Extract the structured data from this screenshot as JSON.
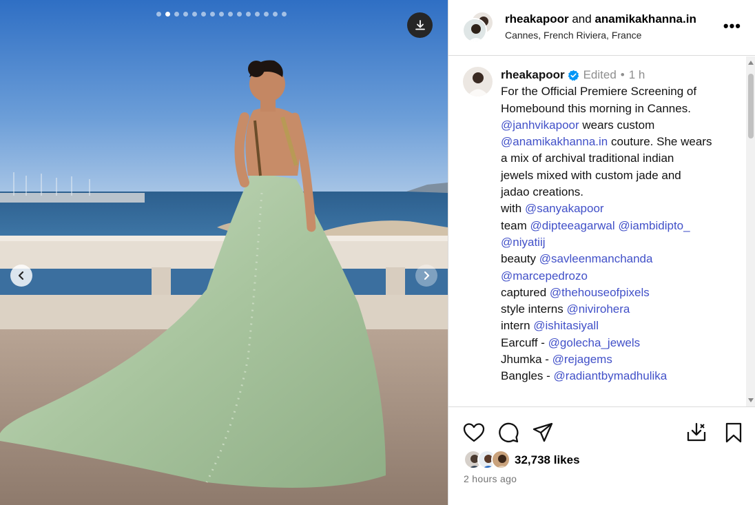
{
  "carousel": {
    "dot_count": 15,
    "active_index": 1
  },
  "header": {
    "user1": "rheakapoor",
    "joiner": "and",
    "user2": "anamikakhanna.in",
    "location": "Cannes, French Riviera, France",
    "more_label": "•••"
  },
  "caption": {
    "username": "rheakapoor",
    "edited": "Edited",
    "separator": "•",
    "time": "1 h",
    "lines": [
      [
        {
          "t": "For the Official Premiere Screening of"
        }
      ],
      [
        {
          "t": "Homebound this morning in Cannes."
        }
      ],
      [
        {
          "t": "@janhvikapoor",
          "m": true
        },
        {
          "t": " wears custom"
        }
      ],
      [
        {
          "t": "@anamikakhanna.in",
          "m": true
        },
        {
          "t": " couture. She wears"
        }
      ],
      [
        {
          "t": "a mix of archival traditional indian"
        }
      ],
      [
        {
          "t": "jewels mixed with custom jade and"
        }
      ],
      [
        {
          "t": "jadao creations."
        }
      ],
      [
        {
          "t": " "
        }
      ],
      [
        {
          "t": "with "
        },
        {
          "t": "@sanyakapoor",
          "m": true
        }
      ],
      [
        {
          "t": "team "
        },
        {
          "t": "@dipteeagarwal",
          "m": true
        },
        {
          "t": " "
        },
        {
          "t": "@iambidipto_",
          "m": true
        }
      ],
      [
        {
          "t": "@niyatiij",
          "m": true
        }
      ],
      [
        {
          "t": "beauty "
        },
        {
          "t": "@savleenmanchanda",
          "m": true
        }
      ],
      [
        {
          "t": "@marcepedrozo",
          "m": true
        }
      ],
      [
        {
          "t": "captured "
        },
        {
          "t": "@thehouseofpixels",
          "m": true
        }
      ],
      [
        {
          "t": "style interns "
        },
        {
          "t": "@nivirohera",
          "m": true
        }
      ],
      [
        {
          "t": "intern "
        },
        {
          "t": "@ishitasiyall",
          "m": true
        }
      ],
      [
        {
          "t": "Earcuff - "
        },
        {
          "t": "@golecha_jewels",
          "m": true
        }
      ],
      [
        {
          "t": "Jhumka - "
        },
        {
          "t": "@rejagems",
          "m": true
        }
      ],
      [
        {
          "t": "Bangles - "
        },
        {
          "t": "@radiantbymadhulika",
          "m": true
        }
      ]
    ]
  },
  "likes": {
    "count_label": "32,738 likes"
  },
  "posted": "2 hours ago",
  "colors": {
    "mention": "#4150c8",
    "verified": "#0095f6",
    "muted": "#8e8e8e"
  }
}
